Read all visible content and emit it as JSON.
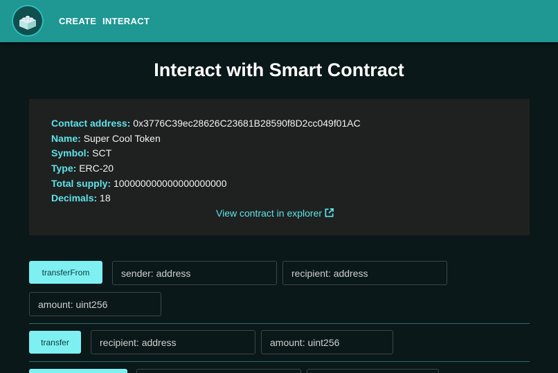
{
  "nav": {
    "links": [
      {
        "label": "CREATE"
      },
      {
        "label": "INTERACT"
      }
    ]
  },
  "page": {
    "title": "Interact with Smart Contract"
  },
  "contract": {
    "address_label": "Contact address:",
    "address": "0x3776C39ec28626C23681B28590f8D2cc049f01AC",
    "name_label": "Name:",
    "name": "Super Cool Token",
    "symbol_label": "Symbol:",
    "symbol": "SCT",
    "type_label": "Type:",
    "type": "ERC-20",
    "supply_label": "Total supply:",
    "supply": "100000000000000000000",
    "decimals_label": "Decimals:",
    "decimals": "18",
    "explorer_link": "View contract in explorer"
  },
  "functions": [
    {
      "name": "transferFrom",
      "params": [
        "sender: address",
        "recipient: address",
        "amount: uint256"
      ]
    },
    {
      "name": "transfer",
      "params": [
        "recipient: address",
        "amount: uint256"
      ]
    }
  ],
  "icons": {
    "logo": "lego-brick-icon",
    "external": "external-link-icon"
  },
  "colors": {
    "navbar": "#1f9793",
    "background": "#0b1819",
    "card": "#1f2121",
    "accent": "#5fe3e8",
    "button": "#7ff0f2"
  }
}
